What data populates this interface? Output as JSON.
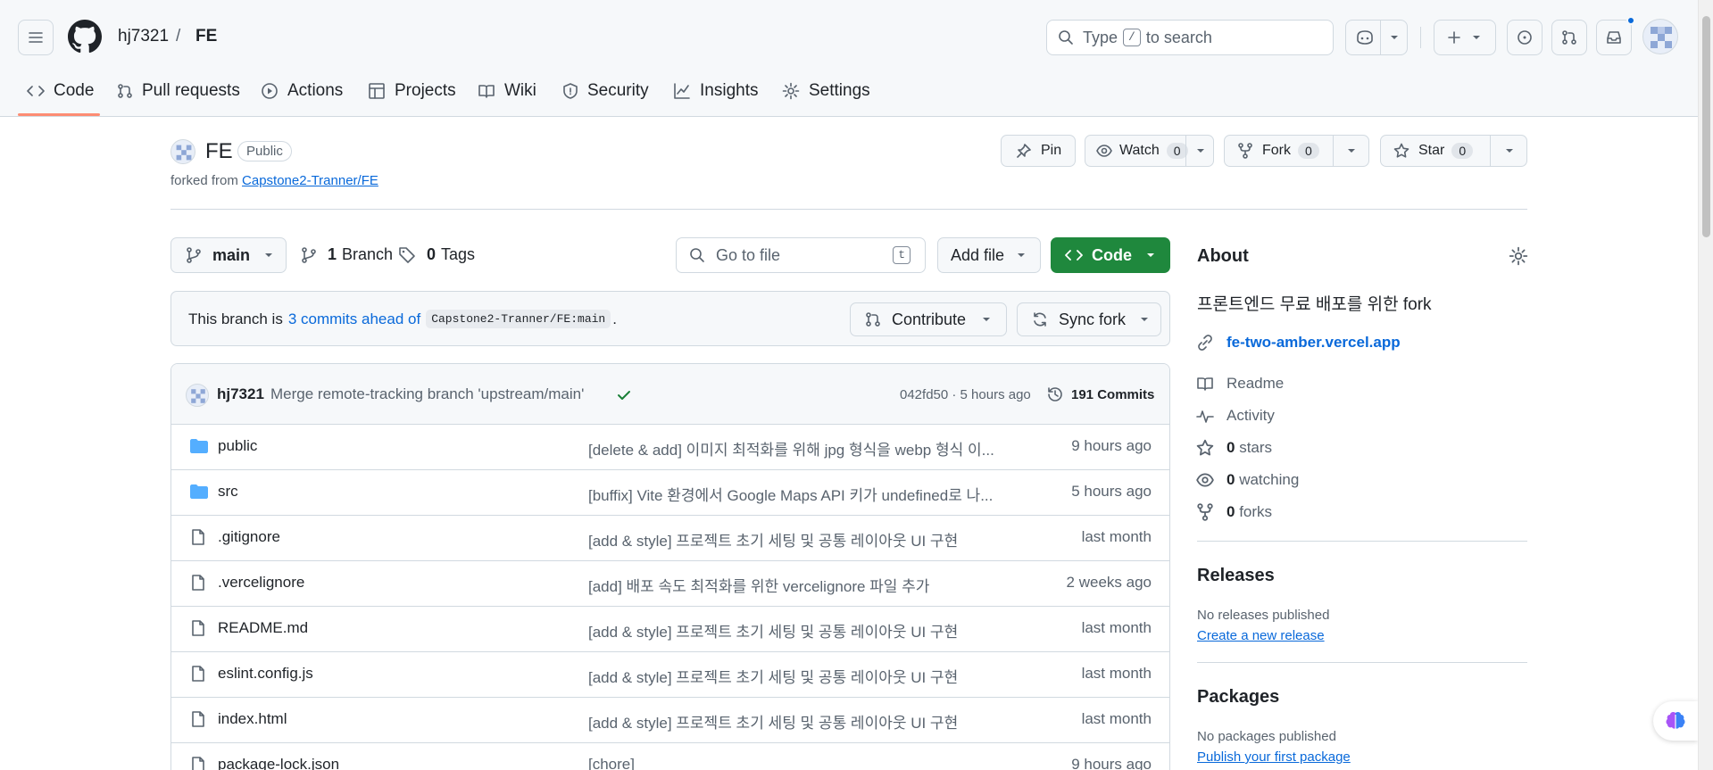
{
  "header": {
    "owner": "hj7321",
    "separator": "/",
    "repo": "FE",
    "search_prefix": "Type",
    "search_key": "/",
    "search_suffix": "to search"
  },
  "tabs": [
    {
      "label": "Code",
      "icon": "code-icon"
    },
    {
      "label": "Pull requests",
      "icon": "git-pull-request-icon"
    },
    {
      "label": "Actions",
      "icon": "play-icon"
    },
    {
      "label": "Projects",
      "icon": "table-icon"
    },
    {
      "label": "Wiki",
      "icon": "book-icon"
    },
    {
      "label": "Security",
      "icon": "shield-icon"
    },
    {
      "label": "Insights",
      "icon": "graph-icon"
    },
    {
      "label": "Settings",
      "icon": "gear-icon"
    }
  ],
  "repo": {
    "name": "FE",
    "visibility": "Public",
    "forked_prefix": "forked from",
    "forked_from": "Capstone2-Tranner/FE",
    "pin": "Pin",
    "watch": "Watch",
    "watch_count": "0",
    "fork": "Fork",
    "fork_count": "0",
    "star": "Star",
    "star_count": "0"
  },
  "toolbar": {
    "branch": "main",
    "branch_count": "1",
    "branch_label": "Branch",
    "tag_count": "0",
    "tag_label": "Tags",
    "goto_placeholder": "Go to file",
    "goto_key": "t",
    "add_file": "Add file",
    "code": "Code"
  },
  "branch_status": {
    "prefix": "This branch is",
    "ahead": "3 commits ahead of",
    "ref": "Capstone2-Tranner/FE:main",
    "suffix": ".",
    "contribute": "Contribute",
    "sync": "Sync fork"
  },
  "latest_commit": {
    "author": "hj7321",
    "message": "Merge remote-tracking branch 'upstream/main'",
    "hash_time": "042fd50 · 5 hours ago",
    "commits": "191 Commits"
  },
  "files": [
    {
      "type": "dir",
      "name": "public",
      "message": "[delete & add] 이미지 최적화를 위해 jpg 형식을 webp 형식 이...",
      "date": "9 hours ago"
    },
    {
      "type": "dir",
      "name": "src",
      "message": "[buffix] Vite 환경에서 Google Maps API 키가 undefined로 나...",
      "date": "5 hours ago"
    },
    {
      "type": "file",
      "name": ".gitignore",
      "message": "[add & style] 프로젝트 초기 세팅 및 공통 레이아웃 UI 구현",
      "date": "last month"
    },
    {
      "type": "file",
      "name": ".vercelignore",
      "message": "[add] 배포 속도 최적화를 위한 vercelignore 파일 추가",
      "date": "2 weeks ago"
    },
    {
      "type": "file",
      "name": "README.md",
      "message": "[add & style] 프로젝트 초기 세팅 및 공통 레이아웃 UI 구현",
      "date": "last month"
    },
    {
      "type": "file",
      "name": "eslint.config.js",
      "message": "[add & style] 프로젝트 초기 세팅 및 공통 레이아웃 UI 구현",
      "date": "last month"
    },
    {
      "type": "file",
      "name": "index.html",
      "message": "[add & style] 프로젝트 초기 세팅 및 공통 레이아웃 UI 구현",
      "date": "last month"
    },
    {
      "type": "file",
      "name": "package-lock.json",
      "message": "[chore]",
      "date": "9 hours ago"
    }
  ],
  "about": {
    "title": "About",
    "description": "프론트엔드 무료 배포를 위한 fork",
    "website": "fe-two-amber.vercel.app",
    "readme": "Readme",
    "activity": "Activity",
    "stars_count": "0",
    "stars": "stars",
    "watching_count": "0",
    "watching": "watching",
    "forks_count": "0",
    "forks": "forks"
  },
  "releases": {
    "title": "Releases",
    "empty": "No releases published",
    "create": "Create a new release"
  },
  "packages": {
    "title": "Packages",
    "empty": "No packages published",
    "publish": "Publish your first package"
  },
  "colors": {
    "accent": "#0969da",
    "primary_button": "#1f883d",
    "active_tab_underline": "#fd8c73",
    "folder": "#54aeff",
    "success": "#1a7f37"
  }
}
